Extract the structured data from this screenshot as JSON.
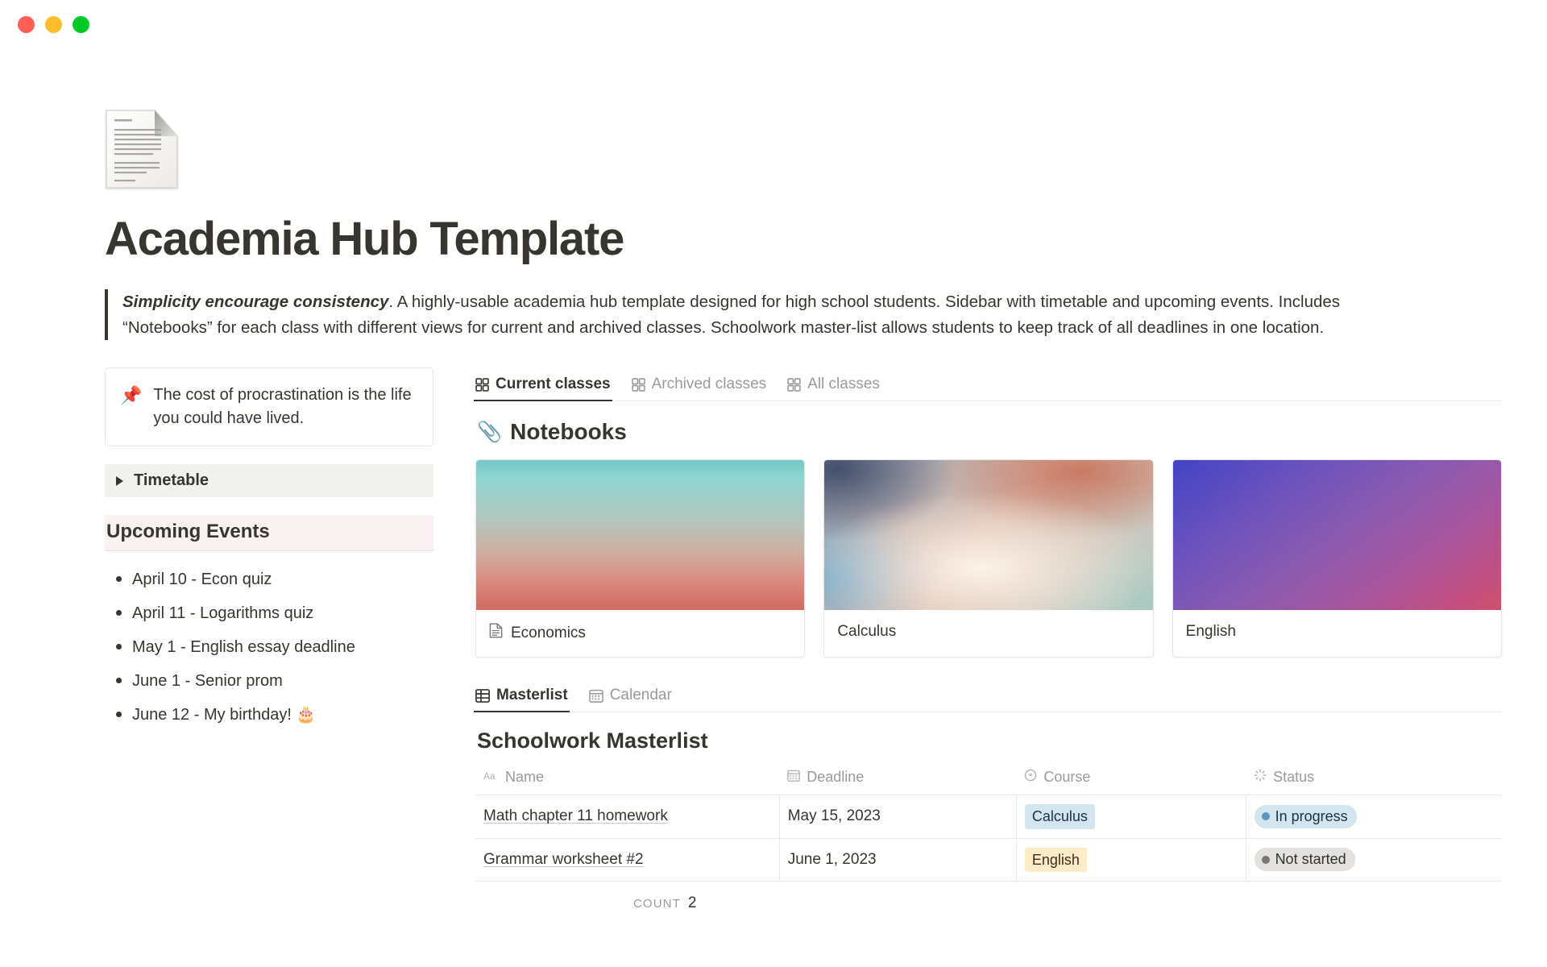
{
  "window": {
    "traffic_lights": [
      {
        "name": "close",
        "color": "#ff5f57"
      },
      {
        "name": "minimize",
        "color": "#ffbd2e"
      },
      {
        "name": "maximize",
        "color": "#00ca28"
      }
    ]
  },
  "page": {
    "icon": "document-page-icon",
    "title": "Academia Hub Template",
    "description_lead": "Simplicity encourage consistency",
    "description_rest": ". A highly-usable academia hub template designed for high school students. Sidebar with timetable and upcoming events. Includes “Notebooks” for each class with different views for current and archived classes. Schoolwork master-list allows students to keep track of all deadlines in one location."
  },
  "sidebar": {
    "callout": {
      "emoji": "📌",
      "text": "The cost of procrastination is the life you could have lived."
    },
    "toggle": {
      "label": "Timetable",
      "expanded": false
    },
    "events_heading": "Upcoming Events",
    "events": [
      "April 10 - Econ quiz",
      "April 11 - Logarithms quiz",
      "May 1 - English essay deadline",
      "June 1 - Senior prom",
      "June 12 - My birthday! 🎂"
    ]
  },
  "notebooks": {
    "tabs": [
      {
        "label": "Current classes",
        "icon": "gallery-view-icon",
        "active": true
      },
      {
        "label": "Archived classes",
        "icon": "gallery-view-icon",
        "active": false
      },
      {
        "label": "All classes",
        "icon": "gallery-view-icon",
        "active": false
      }
    ],
    "title_emoji": "📎",
    "title": "Notebooks",
    "cards": [
      {
        "name": "Economics",
        "has_icon": true,
        "cover": "teal-red-gradient"
      },
      {
        "name": "Calculus",
        "has_icon": false,
        "cover": "blue-peach-gradient"
      },
      {
        "name": "English",
        "has_icon": false,
        "cover": "blue-magenta-gradient"
      }
    ]
  },
  "masterlist": {
    "tabs": [
      {
        "label": "Masterlist",
        "icon": "table-view-icon",
        "active": true
      },
      {
        "label": "Calendar",
        "icon": "calendar-view-icon",
        "active": false
      }
    ],
    "title": "Schoolwork Masterlist",
    "columns": [
      {
        "label": "Name",
        "icon": "text-property-icon"
      },
      {
        "label": "Deadline",
        "icon": "date-property-icon"
      },
      {
        "label": "Course",
        "icon": "select-property-icon"
      },
      {
        "label": "Status",
        "icon": "status-property-icon"
      }
    ],
    "rows": [
      {
        "name": "Math chapter 11 homework",
        "deadline": "May 15, 2023",
        "course": "Calculus",
        "course_color": "blue",
        "status": "In progress",
        "status_color": "inprogress"
      },
      {
        "name": "Grammar worksheet #2",
        "deadline": "June 1, 2023",
        "course": "English",
        "course_color": "yellow",
        "status": "Not started",
        "status_color": "notstarted"
      }
    ],
    "count_label": "COUNT",
    "count_value": "2"
  }
}
